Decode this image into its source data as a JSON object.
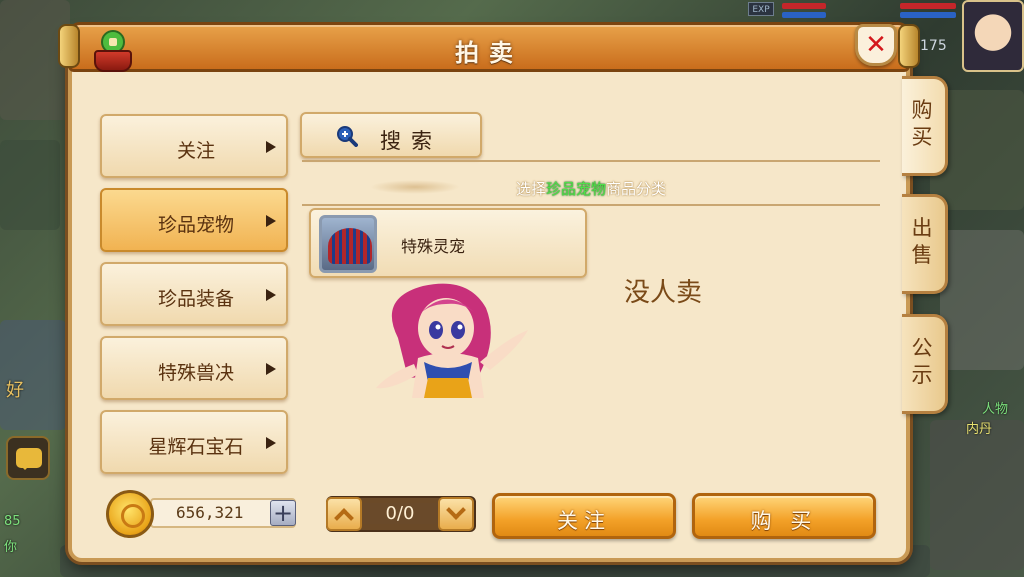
{
  "hud": {
    "exp_label": "EXP",
    "level_number": "175",
    "right_text_1": "人物",
    "right_text_2": "内丹",
    "left_text_1": "好",
    "left_text_2": "85",
    "left_text_3": "你"
  },
  "window": {
    "title": "拍卖",
    "close_symbol": "✕"
  },
  "side_tabs": [
    {
      "label": "购买",
      "active": true
    },
    {
      "label": "出售",
      "active": false
    },
    {
      "label": "公示",
      "active": false
    }
  ],
  "categories": [
    {
      "label": "关注",
      "selected": false
    },
    {
      "label": "珍品宠物",
      "selected": true
    },
    {
      "label": "珍品装备",
      "selected": false
    },
    {
      "label": "特殊兽决",
      "selected": false
    },
    {
      "label": "星辉石宝石",
      "selected": false
    }
  ],
  "search": {
    "label": "搜索"
  },
  "subtitle": {
    "prefix": "选择",
    "highlight": "珍品宠物",
    "suffix": "商品分类"
  },
  "items": [
    {
      "name": "特殊灵宠"
    }
  ],
  "empty_message": "没人卖",
  "currency": {
    "amount": "656,321",
    "add_symbol": "+"
  },
  "pager": {
    "text": "0/0"
  },
  "buttons": {
    "follow": "关注",
    "buy": "购 买"
  },
  "colors": {
    "accent_orange": "#f3a128",
    "panel_bg": "#f6e7c9",
    "highlight_green": "#4fe14a",
    "close_red": "#d4181c"
  }
}
